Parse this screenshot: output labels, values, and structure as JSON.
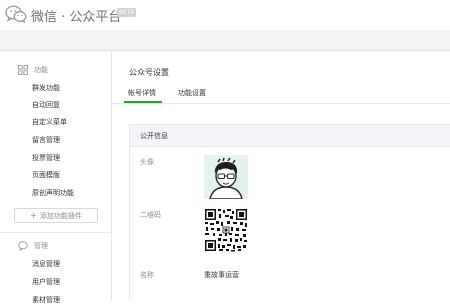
{
  "header": {
    "brand": "微信 · 公众平台",
    "beta_badge": "BETA",
    "logo_icon": "wechat-logo-icon"
  },
  "sidebar": {
    "group_function": {
      "label": "功能",
      "icon": "grid-icon",
      "items": [
        {
          "label": "群发功能"
        },
        {
          "label": "自动回复"
        },
        {
          "label": "自定义菜单"
        },
        {
          "label": "留言管理"
        },
        {
          "label": "投票管理"
        },
        {
          "label": "页面模版"
        },
        {
          "label": "原创声明功能"
        }
      ]
    },
    "add_plugin": {
      "icon": "plus-icon",
      "label": "添加功能插件"
    },
    "group_manage": {
      "label": "管理",
      "icon": "chat-bubble-icon",
      "items": [
        {
          "label": "消息管理"
        },
        {
          "label": "用户管理"
        },
        {
          "label": "素材管理"
        }
      ]
    }
  },
  "main": {
    "title": "公众号设置",
    "tabs": [
      {
        "label": "帐号详情",
        "active": true
      },
      {
        "label": "功能设置",
        "active": false
      }
    ],
    "section": {
      "title": "公开信息",
      "rows": [
        {
          "label": "头像"
        },
        {
          "label": "二维码"
        },
        {
          "label": "名称",
          "value": "重故事运营"
        }
      ]
    }
  },
  "colors": {
    "accent": "#1aad19",
    "panel_header": "#f4f5f9",
    "avatar_bg": "#e4f3ec"
  }
}
